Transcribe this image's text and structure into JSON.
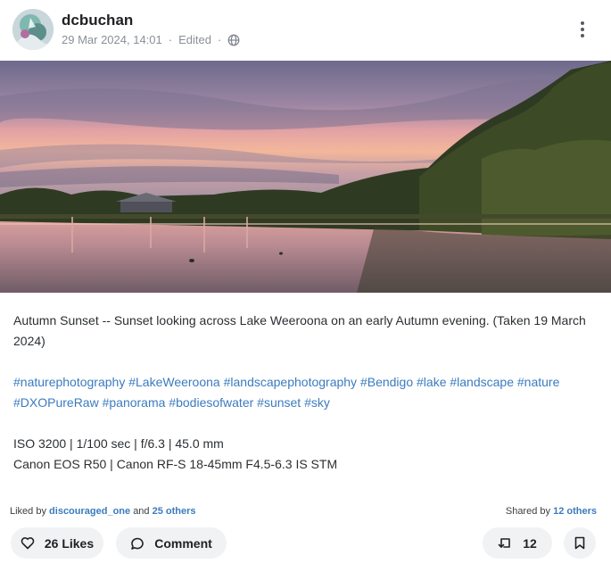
{
  "post": {
    "author": "dcbuchan",
    "timestamp": "29 Mar 2024, 14:01",
    "edited_label": "Edited",
    "visibility_icon": "globe-icon",
    "caption": "Autumn Sunset -- Sunset looking across Lake Weeroona on an early Autumn evening. (Taken 19 March 2024)",
    "hashtags": [
      "#naturephotography",
      "#LakeWeeroona",
      "#landscapephotography",
      "#Bendigo",
      "#lake",
      "#landscape",
      "#nature",
      "#DXOPureRaw",
      "#panorama",
      "#bodiesofwater",
      "#sunset",
      "#sky"
    ],
    "exif_line1": "ISO 3200 | 1/100 sec | f/6.3 | 45.0 mm",
    "exif_line2": "Canon EOS R50 | Canon RF-S 18-45mm F4.5-6.3 IS STM"
  },
  "engagement": {
    "liked_by_prefix": "Liked by",
    "liked_by_user": "discouraged_one",
    "liked_by_and": "and",
    "liked_by_others": "25 others",
    "shared_by_prefix": "Shared by",
    "shared_by_others": "12 others"
  },
  "actions": {
    "likes_label": "26 Likes",
    "comment_label": "Comment",
    "share_count": "12"
  },
  "colors": {
    "link": "#3b7bbf",
    "button_bg": "#f1f2f4"
  }
}
